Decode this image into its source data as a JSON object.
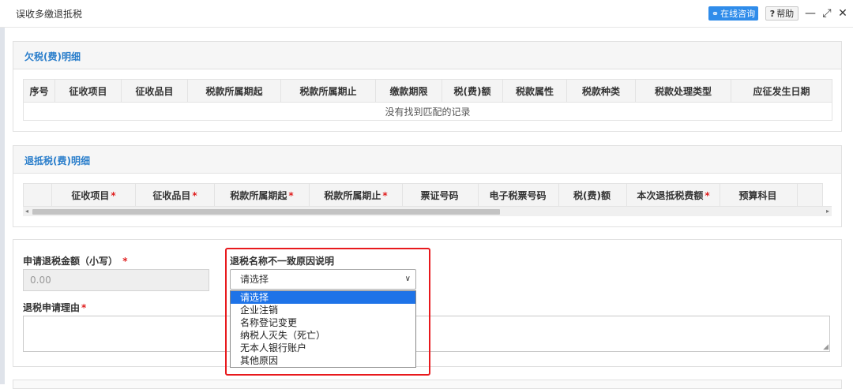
{
  "window": {
    "title": "误收多缴退抵税",
    "consult_label": "在线咨询",
    "help_label": "帮助",
    "minimize": "—",
    "maximize": "⤢",
    "close": "✕"
  },
  "arrears": {
    "title": "欠税(费)明细",
    "columns": [
      "序号",
      "征收项目",
      "征收品目",
      "税款所属期起",
      "税款所属期止",
      "缴款期限",
      "税(费)额",
      "税款属性",
      "税款种类",
      "税款处理类型",
      "应征发生日期"
    ],
    "empty_text": "没有找到匹配的记录"
  },
  "refund": {
    "title": "退抵税(费)明细",
    "columns": [
      {
        "label": "征收项目",
        "required": "*"
      },
      {
        "label": "征收品目",
        "required": "*"
      },
      {
        "label": "税款所属期起",
        "required": "*"
      },
      {
        "label": "税款所属期止",
        "required": "*"
      },
      {
        "label": "票证号码",
        "required": ""
      },
      {
        "label": "电子税票号码",
        "required": ""
      },
      {
        "label": "税(费)额",
        "required": ""
      },
      {
        "label": "本次退抵税费额",
        "required": "*"
      },
      {
        "label": "预算科目",
        "required": ""
      }
    ]
  },
  "form": {
    "amount_label": "申请退税金额（小写）",
    "amount_required": "*",
    "amount_value": "0.00",
    "reason_label": "退税名称不一致原因说明",
    "select_value": "请选择",
    "refund_reason_label": "退税申请理由",
    "refund_reason_required": "*",
    "options": [
      "请选择",
      "企业注销",
      "名称登记变更",
      "纳税人灭失（死亡）",
      "无本人银行账户",
      "其他原因"
    ],
    "selected_index": 0
  },
  "colors": {
    "accent": "#2a7ecb",
    "highlight": "#e8191d",
    "option_selected": "#1e73e8"
  }
}
